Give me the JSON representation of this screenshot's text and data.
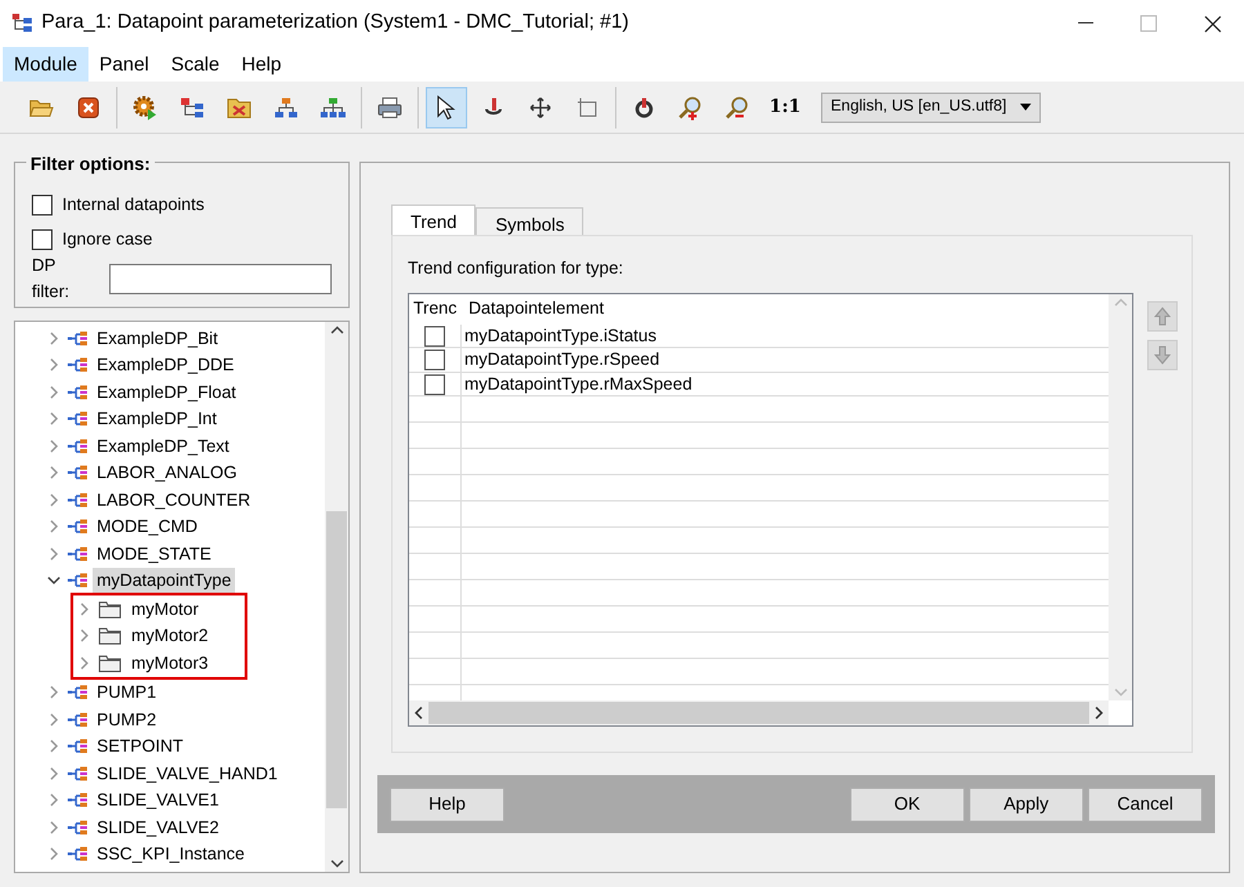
{
  "window": {
    "title": "Para_1: Datapoint parameterization (System1 - DMC_Tutorial; #1)"
  },
  "menu": [
    {
      "label": "Module",
      "selected": true
    },
    {
      "label": "Panel",
      "selected": false
    },
    {
      "label": "Scale",
      "selected": false
    },
    {
      "label": "Help",
      "selected": false
    }
  ],
  "toolbar": {
    "groups": [
      [
        {
          "kind": "open",
          "pressed": false
        },
        {
          "kind": "close",
          "pressed": false
        }
      ],
      [
        {
          "kind": "gear",
          "pressed": false
        },
        {
          "kind": "tree",
          "pressed": false
        },
        {
          "kind": "tools",
          "pressed": false
        },
        {
          "kind": "hierarchy",
          "pressed": false
        },
        {
          "kind": "hierarchy-wide",
          "pressed": false
        }
      ],
      [
        {
          "kind": "print",
          "pressed": false
        }
      ],
      [
        {
          "kind": "pointer",
          "pressed": true
        },
        {
          "kind": "rotate",
          "pressed": false
        },
        {
          "kind": "move",
          "pressed": false
        },
        {
          "kind": "rect",
          "pressed": false
        }
      ],
      [
        {
          "kind": "refresh",
          "pressed": false
        },
        {
          "kind": "zoom-in",
          "pressed": false
        },
        {
          "kind": "zoom-out",
          "pressed": false
        },
        {
          "kind": "text",
          "label": "1:1",
          "pressed": false
        }
      ]
    ],
    "language": "English, US [en_US.utf8]"
  },
  "filter": {
    "title": "Filter options:",
    "options": [
      {
        "label": "Internal datapoints",
        "checked": false
      },
      {
        "label": "Ignore case",
        "checked": false
      }
    ],
    "dp_filter_label": "DP filter:"
  },
  "tree": {
    "items": [
      {
        "label": "ExampleDP_Bit",
        "expanded": false,
        "selected": false
      },
      {
        "label": "ExampleDP_DDE",
        "expanded": false,
        "selected": false
      },
      {
        "label": "ExampleDP_Float",
        "expanded": false,
        "selected": false
      },
      {
        "label": "ExampleDP_Int",
        "expanded": false,
        "selected": false
      },
      {
        "label": "ExampleDP_Text",
        "expanded": false,
        "selected": false
      },
      {
        "label": "LABOR_ANALOG",
        "expanded": false,
        "selected": false
      },
      {
        "label": "LABOR_COUNTER",
        "expanded": false,
        "selected": false
      },
      {
        "label": "MODE_CMD",
        "expanded": false,
        "selected": false
      },
      {
        "label": "MODE_STATE",
        "expanded": false,
        "selected": false
      },
      {
        "label": "myDatapointType",
        "expanded": true,
        "selected": true,
        "children_highlighted": true,
        "children": [
          {
            "label": "myMotor",
            "expanded": false,
            "selected": false
          },
          {
            "label": "myMotor2",
            "expanded": false,
            "selected": false
          },
          {
            "label": "myMotor3",
            "expanded": false,
            "selected": false
          }
        ]
      },
      {
        "label": "PUMP1",
        "expanded": false,
        "selected": false
      },
      {
        "label": "PUMP2",
        "expanded": false,
        "selected": false
      },
      {
        "label": "SETPOINT",
        "expanded": false,
        "selected": false
      },
      {
        "label": "SLIDE_VALVE_HAND1",
        "expanded": false,
        "selected": false
      },
      {
        "label": "SLIDE_VALVE1",
        "expanded": false,
        "selected": false
      },
      {
        "label": "SLIDE_VALVE2",
        "expanded": false,
        "selected": false
      },
      {
        "label": "SSC_KPI_Instance",
        "expanded": false,
        "selected": false
      }
    ]
  },
  "tabs": [
    {
      "label": "Trend",
      "selected": true
    },
    {
      "label": "Symbols",
      "selected": false
    }
  ],
  "trend": {
    "caption": "Trend configuration for type:",
    "columns": [
      "Trenc",
      "Datapointelement"
    ],
    "rows": [
      {
        "checked": false,
        "element": "myDatapointType.iStatus"
      },
      {
        "checked": false,
        "element": "myDatapointType.rSpeed"
      },
      {
        "checked": false,
        "element": "myDatapointType.rMaxSpeed"
      }
    ]
  },
  "buttons": {
    "left": [
      "Help"
    ],
    "right": [
      "OK",
      "Apply",
      "Cancel"
    ]
  }
}
